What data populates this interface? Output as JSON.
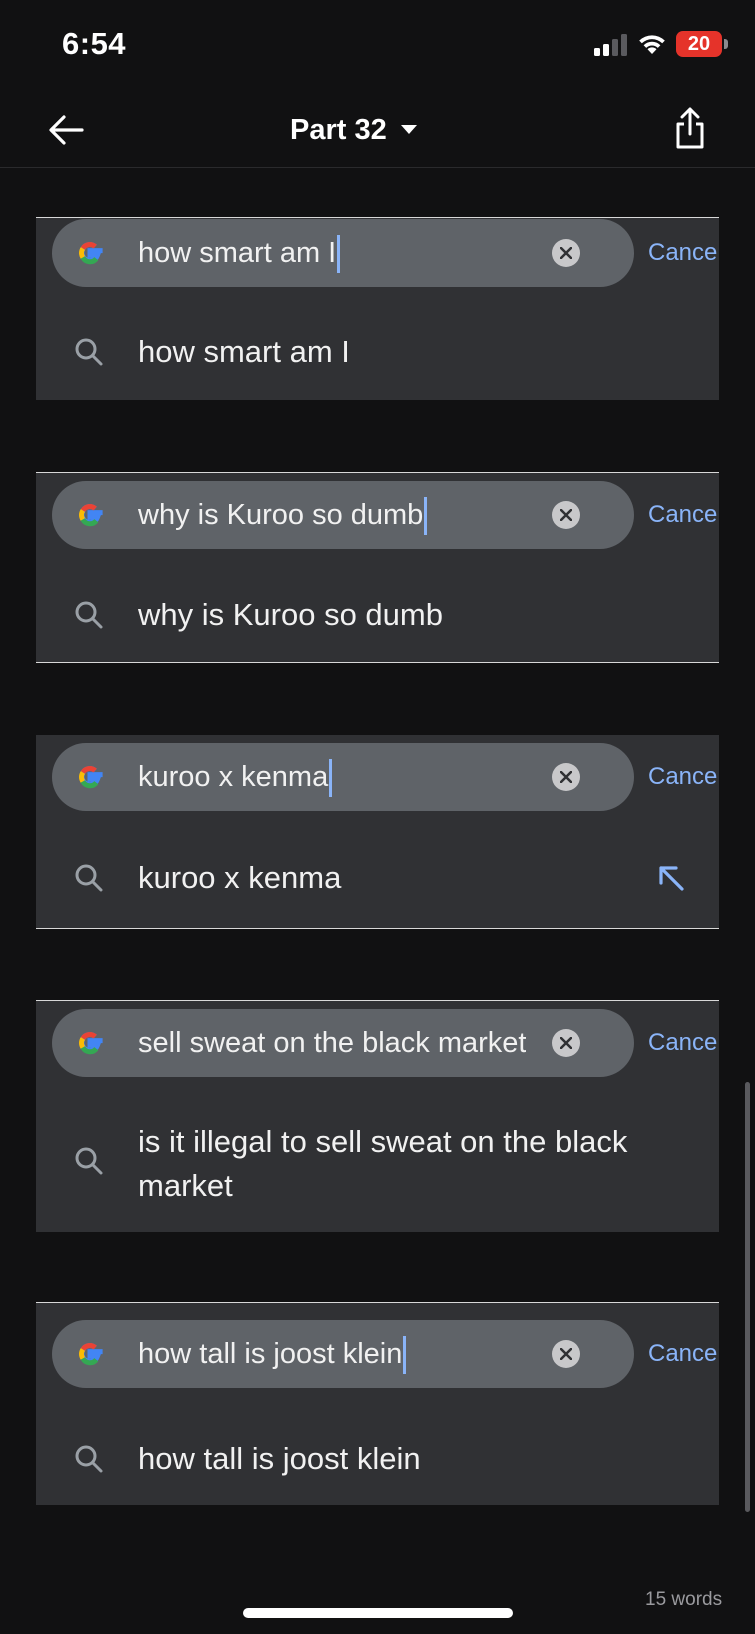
{
  "status_bar": {
    "time": "6:54",
    "battery": "20"
  },
  "nav": {
    "title": "Part 32"
  },
  "cards": [
    {
      "query": "how smart am I",
      "cancel_label": "Cancel",
      "suggestion": "how smart am I"
    },
    {
      "query": "why is Kuroo so dumb",
      "cancel_label": "Cancel",
      "suggestion": "why is Kuroo so dumb"
    },
    {
      "query": "kuroo x kenma",
      "cancel_label": "Cancel",
      "suggestion": "kuroo x kenma"
    },
    {
      "query": "sell sweat on the black market",
      "cancel_label": "Cancel",
      "suggestion": "is it illegal to sell sweat on the black market"
    },
    {
      "query": "how tall is joost klein",
      "cancel_label": "Cancel",
      "suggestion": "how tall is joost klein"
    }
  ],
  "footer": {
    "word_count": "15 words"
  },
  "colors": {
    "accent": "#8ab4f8",
    "card_bg": "#303134",
    "pill_bg": "#5f6368",
    "page_bg": "#111112",
    "battery_red": "#e5332a"
  },
  "icons": [
    "back-arrow-icon",
    "chevron-down-icon",
    "share-icon",
    "google-logo-icon",
    "clear-icon",
    "search-icon",
    "fill-arrow-icon",
    "wifi-icon",
    "signal-icon"
  ]
}
